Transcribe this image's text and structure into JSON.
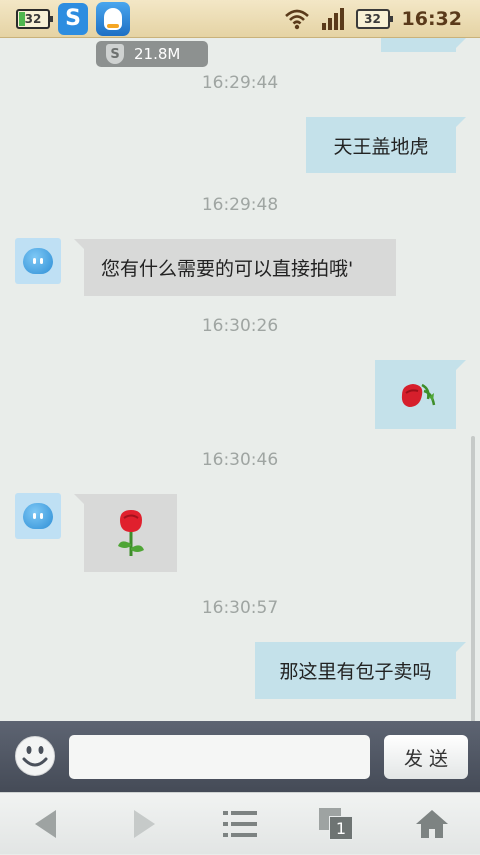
{
  "status_bar": {
    "notification_battery_text": "32",
    "battery_text": "32",
    "time": "16:32",
    "icons": [
      "battery-notification-icon",
      "shield-app-icon",
      "qq-app-icon",
      "wifi-icon",
      "signal-icon",
      "battery-icon"
    ]
  },
  "traffic_chip": {
    "shield_glyph": "S",
    "value": "21.8M"
  },
  "messages": [
    {
      "type": "timestamp",
      "text": "16:29:44"
    },
    {
      "type": "outgoing",
      "text": "天王盖地虎"
    },
    {
      "type": "timestamp",
      "text": "16:29:48"
    },
    {
      "type": "incoming",
      "text": "您有什么需要的可以直接拍哦'"
    },
    {
      "type": "timestamp",
      "text": "16:30:26"
    },
    {
      "type": "outgoing",
      "emoticon": "wilted-rose"
    },
    {
      "type": "timestamp",
      "text": "16:30:46"
    },
    {
      "type": "incoming",
      "emoticon": "rose"
    },
    {
      "type": "timestamp",
      "text": "16:30:57"
    },
    {
      "type": "outgoing",
      "text": "那这里有包子卖吗"
    }
  ],
  "input_bar": {
    "message_value": "",
    "send_label": "发送"
  },
  "nav": [
    "back-icon",
    "forward-icon",
    "menu-icon",
    "windows-icon",
    "home-icon"
  ],
  "nav_window_count": "1",
  "colors": {
    "outgoing_bubble": "#c4e1ea",
    "incoming_bubble": "#d8d9d8",
    "background": "#e9edea"
  }
}
